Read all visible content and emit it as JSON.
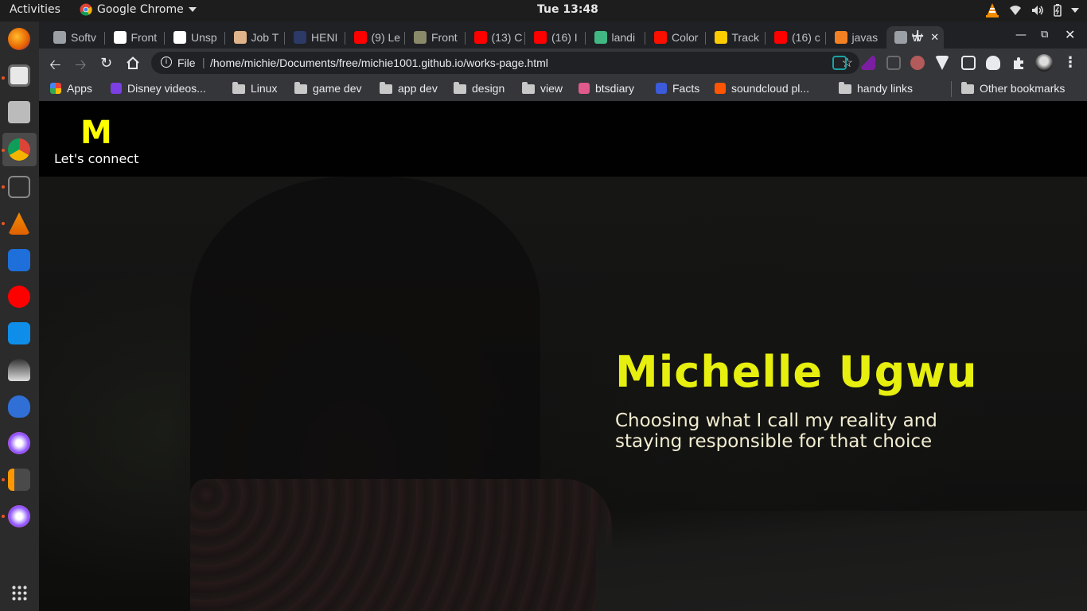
{
  "system": {
    "activities": "Activities",
    "app_name": "Google Chrome",
    "clock": "Tue 13:48"
  },
  "browser": {
    "tabs": [
      {
        "label": "Softv",
        "favicon_color": "#9aa0a6"
      },
      {
        "label": "Front",
        "favicon_color": "#ffffff"
      },
      {
        "label": "Unsp",
        "favicon_color": "#ffffff"
      },
      {
        "label": "Job T",
        "favicon_color": "#e0b48a"
      },
      {
        "label": "HENI",
        "favicon_color": "#2b3a67"
      },
      {
        "label": "(9) Le",
        "favicon_color": "#ff0000"
      },
      {
        "label": "Front",
        "favicon_color": "#8a8a6a"
      },
      {
        "label": "(13) C",
        "favicon_color": "#ff0000"
      },
      {
        "label": "(16) I",
        "favicon_color": "#ff0000"
      },
      {
        "label": "landi",
        "favicon_color": "#41b883"
      },
      {
        "label": "Color",
        "favicon_color": "#fa0f00"
      },
      {
        "label": "Track",
        "favicon_color": "#ffcc00"
      },
      {
        "label": "(16) c",
        "favicon_color": "#ff0000"
      },
      {
        "label": "javas",
        "favicon_color": "#f48024"
      },
      {
        "label": "W",
        "favicon_color": "#9aa0a6",
        "active": true
      }
    ],
    "address": {
      "scheme": "File",
      "url": "/home/michie/Documents/free/michie1001.github.io/works-page.html"
    },
    "bookmarks": [
      {
        "label": "Apps",
        "kind": "apps"
      },
      {
        "label": "Disney videos...",
        "kind": "site",
        "color": "#7b3fe4"
      },
      {
        "label": "Linux",
        "kind": "folder"
      },
      {
        "label": "game dev",
        "kind": "folder"
      },
      {
        "label": "app dev",
        "kind": "folder"
      },
      {
        "label": "design",
        "kind": "folder"
      },
      {
        "label": "view",
        "kind": "folder"
      },
      {
        "label": "btsdiary",
        "kind": "site",
        "color": "#e05a8a"
      },
      {
        "label": "Facts",
        "kind": "site",
        "color": "#3b5bdb"
      },
      {
        "label": "soundcloud pl...",
        "kind": "site",
        "color": "#ff5500"
      },
      {
        "label": "handy links",
        "kind": "folder"
      }
    ],
    "other_bookmarks": "Other bookmarks"
  },
  "site": {
    "logo": "M",
    "connect": "Let's connect",
    "hero_title": "Michelle Ugwu",
    "hero_subtitle": "Choosing what I call my reality and staying responsible for that choice"
  }
}
